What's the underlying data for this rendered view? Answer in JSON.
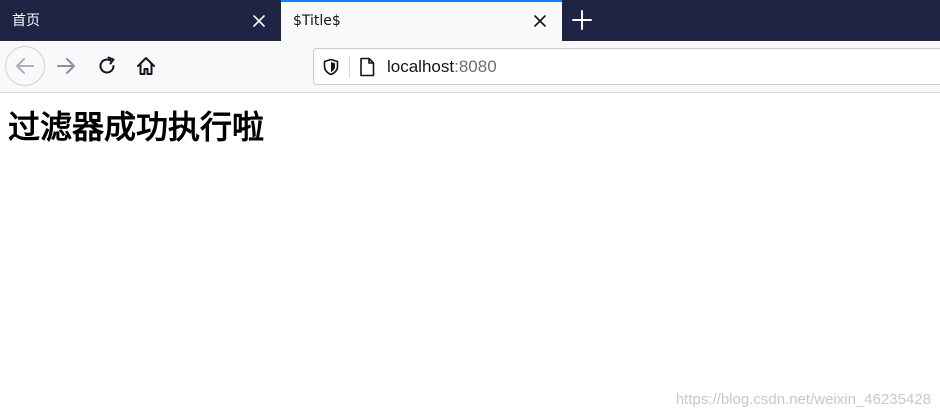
{
  "tabs": [
    {
      "label": "首页",
      "active": false
    },
    {
      "label": "$Title$",
      "active": true
    }
  ],
  "toolbar": {
    "url_host": "localhost",
    "url_port": ":8080"
  },
  "page": {
    "heading": "过滤器成功执行啦"
  },
  "watermark": "https://blog.csdn.net/weixin_46235428",
  "icons": {
    "back": "arrow-left-icon",
    "forward": "arrow-right-icon",
    "reload": "reload-icon",
    "home": "home-icon",
    "close": "close-icon",
    "new_tab": "plus-icon",
    "tracking": "shield-icon",
    "page": "page-icon"
  },
  "colors": {
    "tabstrip": "#1f2445",
    "active_tab": "#f9f9fb",
    "accent": "#0a84ff"
  }
}
